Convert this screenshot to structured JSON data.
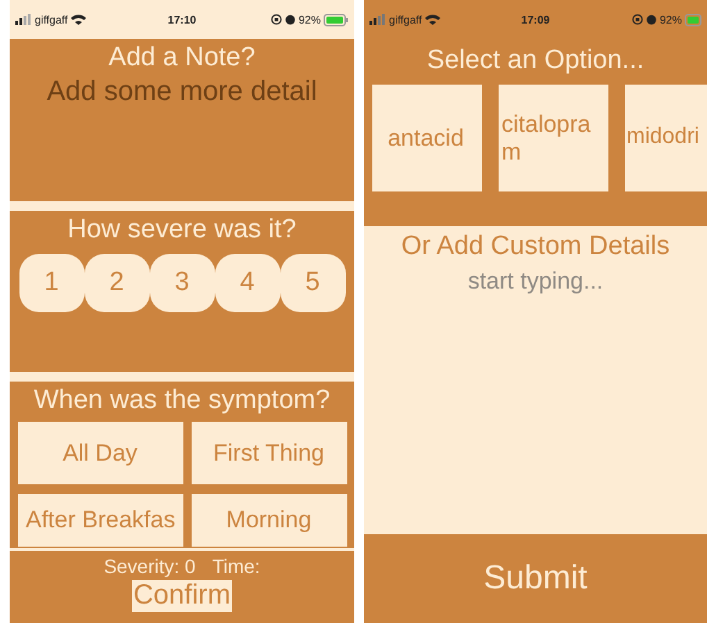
{
  "symptom_screen": {
    "status_bar": {
      "carrier": "giffgaff",
      "time": "17:10",
      "battery": "92%"
    },
    "note": {
      "title": "Add a Note?",
      "placeholder": "Add some more detail"
    },
    "severity": {
      "title": "How severe was it?",
      "options": [
        "1",
        "2",
        "3",
        "4",
        "5"
      ]
    },
    "timing": {
      "title": "When was the symptom?",
      "options": [
        "All Day",
        "First Thing",
        "After Breakfas",
        "Morning"
      ]
    },
    "footer": {
      "severity": "Severity: 0",
      "time": "Time:",
      "confirm": "Confirm"
    }
  },
  "options_screen": {
    "status_bar": {
      "carrier": "giffgaff",
      "time": "17:09",
      "battery": "92%"
    },
    "title": "Select an Option...",
    "options": [
      "antacid",
      "citalopram",
      "midodri"
    ],
    "custom": {
      "title": "Or Add Custom Details",
      "placeholder": "start typing..."
    },
    "submit": "Submit"
  }
}
